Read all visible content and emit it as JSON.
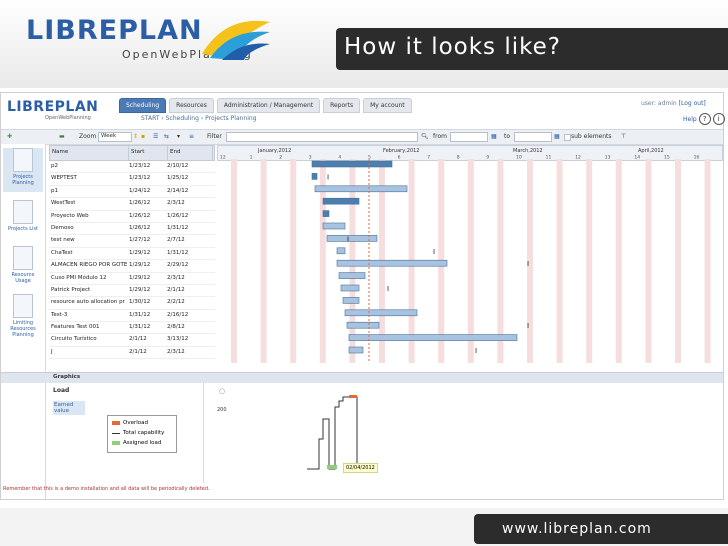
{
  "slide": {
    "logo_libre": "LIBRE",
    "logo_plan": "PLAN",
    "logo_sub": "OpenWebPlanning",
    "title": "How it looks like?",
    "footer_url": "www.libreplan.com"
  },
  "app": {
    "logo": "LIBREPLAN",
    "logo_sub": "OpenWebPlanning",
    "tabs": [
      "Scheduling",
      "Resources",
      "Administration / Management",
      "Reports",
      "My account"
    ],
    "active_tab": "Scheduling",
    "breadcrumb": "START  ›  Scheduling  ›  Projects Planning",
    "user": "user: admin",
    "logout": "[Log out]",
    "help": "Help"
  },
  "toolbar": {
    "zoom_label": "Zoom",
    "zoom_value": "Week",
    "filter_label": "Filter",
    "from_label": "from",
    "to_label": "to",
    "subelements_label": "sub elements"
  },
  "sidebar": {
    "items": [
      "Projects Planning",
      "Projects List",
      "Resource Usage",
      "Limiting Resources Planning"
    ]
  },
  "grid": {
    "headers": [
      "Name",
      "Start",
      "End"
    ],
    "rows": [
      [
        "p2",
        "1/23/12",
        "2/10/12"
      ],
      [
        "WEPTEST",
        "1/23/12",
        "1/25/12"
      ],
      [
        "p1",
        "1/24/12",
        "2/14/12"
      ],
      [
        "WestTest",
        "1/26/12",
        "2/3/12"
      ],
      [
        "Proyecto Web",
        "1/26/12",
        "1/26/12"
      ],
      [
        "Demoso",
        "1/26/12",
        "1/31/12"
      ],
      [
        "test new",
        "1/27/12",
        "2/7/12"
      ],
      [
        "ChaTest",
        "1/29/12",
        "1/31/12"
      ],
      [
        "ALMACEN RIEGO POR GOTEO",
        "1/29/12",
        "2/29/12"
      ],
      [
        "Cuso PMI Módulo 12",
        "1/29/12",
        "2/3/12"
      ],
      [
        "Patrick Project",
        "1/29/12",
        "2/1/12"
      ],
      [
        "resource auto allocation pr",
        "1/30/12",
        "2/2/12"
      ],
      [
        "Test-3",
        "1/31/12",
        "2/16/12"
      ],
      [
        "Features Test 001",
        "1/31/12",
        "2/8/12"
      ],
      [
        "Circuito Turístico",
        "2/1/12",
        "3/13/12"
      ],
      [
        "J",
        "2/1/12",
        "2/3/12"
      ]
    ]
  },
  "timeline": {
    "months": [
      "January,2012",
      "February,2012",
      "March,2012",
      "April,2012"
    ],
    "days": [
      "12",
      "1",
      "2",
      "3",
      "4",
      "5",
      "6",
      "7",
      "8",
      "9",
      "10",
      "11",
      "12",
      "13",
      "14",
      "15",
      "16"
    ]
  },
  "lower": {
    "section_title": "Graphics",
    "tab_load": "Load",
    "tab_earned": "Earned value",
    "legend": [
      "Overload",
      "Total capability",
      "Assigned load"
    ],
    "legend_colors": [
      "#e06a3a",
      "#333333",
      "#8ed07a"
    ],
    "y_tick": "200",
    "date_tooltip": "02/04/2012"
  },
  "note": "Remember that this is a demo installation and all data will be periodically deleted."
}
